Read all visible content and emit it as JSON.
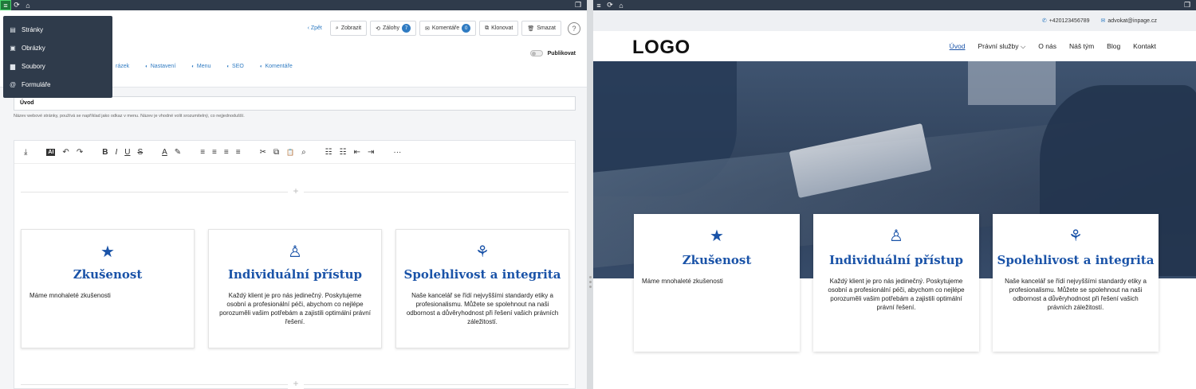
{
  "left": {
    "topbar": {
      "menu_icon": "≡",
      "refresh_icon": "⟳",
      "home_icon": "⌂",
      "window_icon": "❐"
    },
    "dropdown": {
      "items": [
        {
          "icon": "▤",
          "label": "Stránky"
        },
        {
          "icon": "▣",
          "label": "Obrázky"
        },
        {
          "icon": "▆",
          "label": "Soubory"
        },
        {
          "icon": "@",
          "label": "Formuláře"
        }
      ]
    },
    "actions": {
      "back": "‹ Zpět",
      "show": "Zobrazit",
      "backups": "Zálohy",
      "backups_count": "7",
      "comments": "Komentáře",
      "comments_count": "0",
      "clone": "Klonovat",
      "delete": "Smazat",
      "help": "?"
    },
    "publish_label": "Publikovat",
    "tabs": [
      {
        "icon": "",
        "label": "rázek"
      },
      {
        "icon": "◐",
        "label": "Nastavení"
      },
      {
        "icon": "◐",
        "label": "Menu"
      },
      {
        "icon": "◐",
        "label": "SEO"
      },
      {
        "icon": "◐",
        "label": "Komentáře"
      }
    ],
    "title_value": "Úvod",
    "title_help": "Název webové stránky, používá se například jako odkaz v menu. Název je vhodné volit srozumitelný, co nejjednodušší.",
    "toolbar": [
      "⤓",
      "AI",
      "↶",
      "↷",
      "B",
      "I",
      "U",
      "S",
      "A",
      "✎",
      "≡",
      "≡",
      "≡",
      "≡",
      "✂",
      "⧉",
      "📋",
      "⌕",
      "☷",
      "☷",
      "⇤",
      "⇥",
      "···"
    ],
    "plus": "+",
    "cards": [
      {
        "icon": "★",
        "title": "Zkušenost",
        "text": "Máme mnohaleté zkušenosti",
        "align": "left"
      },
      {
        "icon": "♙",
        "title": "Individuální přístup",
        "text": "Každý klient je pro nás jedinečný. Poskytujeme osobní a profesionální péči, abychom co nejlépe porozuměli vašim potřebám a zajistili optimální právní řešení.",
        "align": "center"
      },
      {
        "icon": "⚘",
        "title": "Spolehlivost a integrita",
        "text": "Naše kancelář se řídí nejvyššími standardy etiky a profesionalismu. Můžete se spolehnout na naši odbornost a důvěryhodnost při řešení vašich právních záležitostí.",
        "align": "center"
      }
    ]
  },
  "right": {
    "topbar": {
      "menu_icon": "≡",
      "refresh_icon": "⟳",
      "home_icon": "⌂",
      "window_icon": "❐"
    },
    "contact": {
      "phone": "+420123456789",
      "email": "advokat@inpage.cz"
    },
    "logo": "LOGO",
    "nav": [
      "Úvod",
      "Právní služby ⌵",
      "O nás",
      "Náš tým",
      "Blog",
      "Kontakt"
    ],
    "cards": [
      {
        "icon": "★",
        "title": "Zkušenost",
        "text": "Máme mnohaleté zkušenosti",
        "align": "left"
      },
      {
        "icon": "♙",
        "title": "Individuální přístup",
        "text": "Každý klient je pro nás jedinečný. Poskytujeme osobní a profesionální péči, abychom co nejlépe porozuměli vašim potřebám a zajistili optimální právní řešení.",
        "align": "center"
      },
      {
        "icon": "⚘",
        "title": "Spolehlivost a integrita",
        "text": "Naše kancelář se řídí nejvyššími standardy etiky a profesionalismu. Můžete se spolehnout na naši odbornost a důvěryhodnost při řešení vašich právních záležitostí.",
        "align": "center"
      }
    ]
  },
  "colors": {
    "accent": "#1a53a8",
    "link": "#2f7bc2",
    "topbar": "#2f3b4b"
  }
}
